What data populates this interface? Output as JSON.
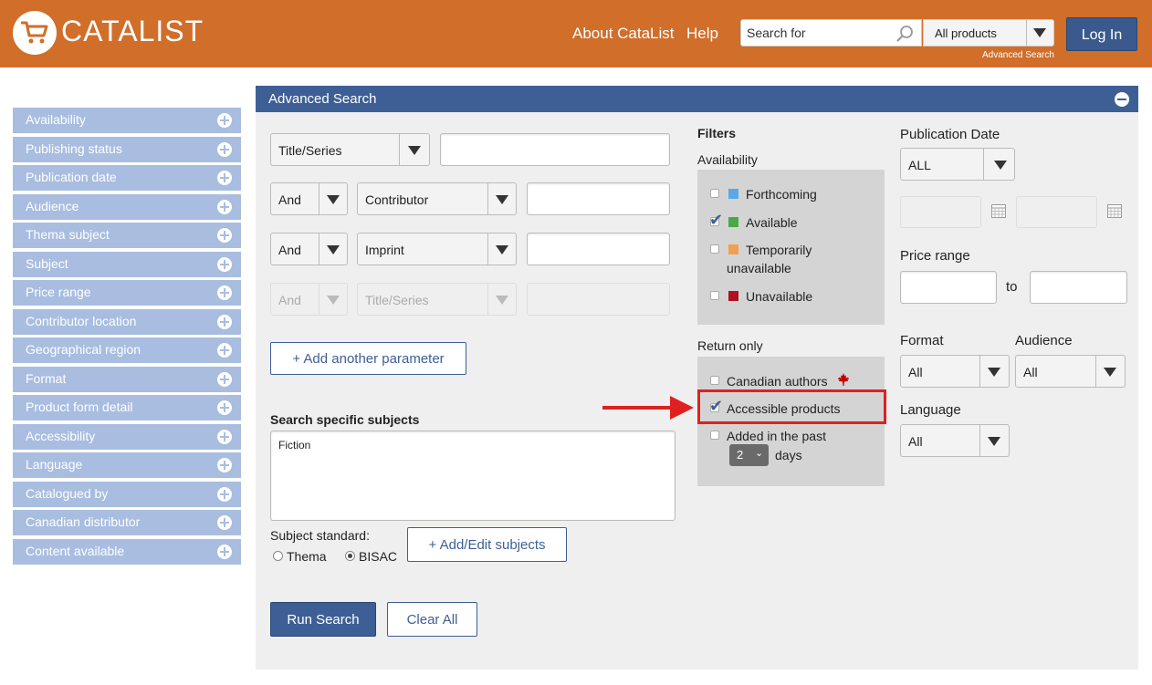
{
  "header": {
    "brand": "CATALIST",
    "nav": [
      "About CataList",
      "Help"
    ],
    "search_placeholder": "Search for",
    "product_select": "All products",
    "advanced_link": "Advanced Search",
    "login": "Log In"
  },
  "sidebar": {
    "items": [
      "Availability",
      "Publishing status",
      "Publication date",
      "Audience",
      "Thema subject",
      "Subject",
      "Price range",
      "Contributor location",
      "Geographical region",
      "Format",
      "Product form detail",
      "Accessibility",
      "Language",
      "Catalogued by",
      "Canadian distributor",
      "Content available"
    ]
  },
  "panel": {
    "title": "Advanced Search",
    "rows": [
      {
        "op": "",
        "field": "Title/Series"
      },
      {
        "op": "And",
        "field": "Contributor"
      },
      {
        "op": "And",
        "field": "Imprint"
      },
      {
        "op": "And",
        "field": "Title/Series"
      }
    ],
    "add_param": "+ Add another parameter",
    "subjects_label": "Search specific subjects",
    "subjects_value": "Fiction",
    "subject_standard_label": "Subject standard:",
    "subject_standards": [
      "Thema",
      "BISAC"
    ],
    "selected_standard": "BISAC",
    "add_subjects": "+ Add/Edit subjects",
    "run_search": "Run Search",
    "clear_all": "Clear All",
    "filters": {
      "title": "Filters",
      "availability_label": "Availability",
      "availability": [
        {
          "label": "Forthcoming",
          "checked": false,
          "color": "#5aa8e8"
        },
        {
          "label": "Available",
          "checked": true,
          "color": "#4aa84a"
        },
        {
          "label": "Temporarily",
          "label2": "unavailable",
          "checked": false,
          "color": "#f0a050"
        },
        {
          "label": "Unavailable",
          "checked": false,
          "color": "#b01020"
        }
      ],
      "return_only_label": "Return only",
      "canadian": "Canadian authors",
      "accessible": "Accessible products",
      "added_label": "Added in the past",
      "added_days_value": "2",
      "added_days_unit": "days"
    },
    "pub_date_label": "Publication Date",
    "pub_date_value": "ALL",
    "price_range_label": "Price range",
    "price_to": "to",
    "format_label": "Format",
    "format_value": "All",
    "audience_label": "Audience",
    "audience_value": "All",
    "language_label": "Language",
    "language_value": "All"
  }
}
